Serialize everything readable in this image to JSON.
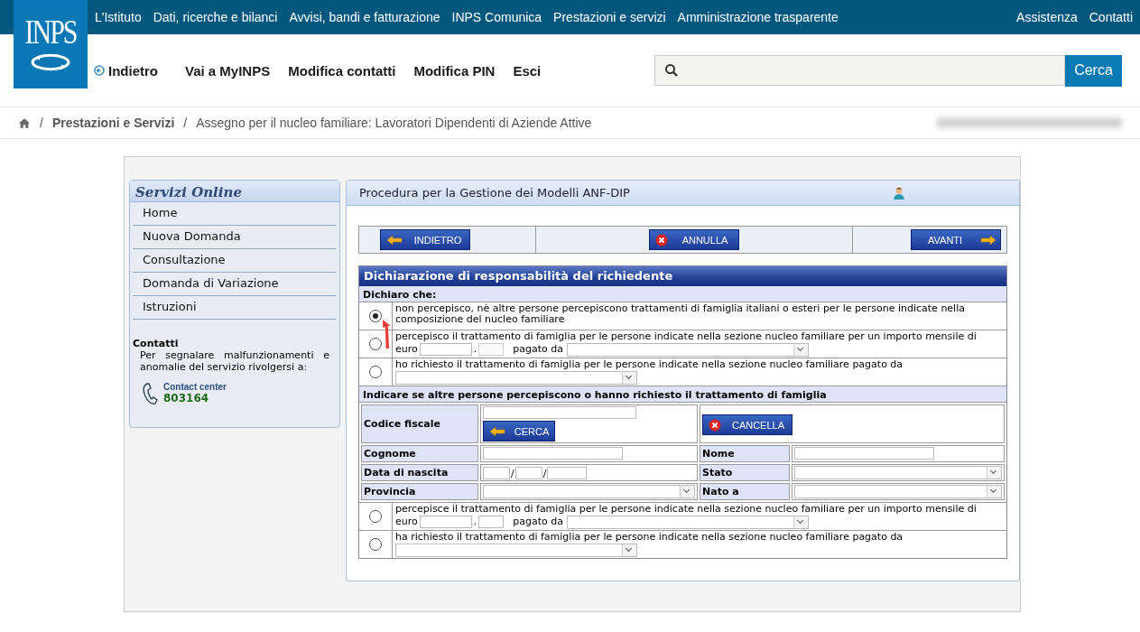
{
  "top_nav": {
    "links": [
      "L'Istituto",
      "Dati, ricerche e bilanci",
      "Avvisi, bandi e fatturazione",
      "INPS Comunica",
      "Prestazioni e servizi",
      "Amministrazione trasparente"
    ],
    "right_links": [
      "Assistenza",
      "Contatti"
    ]
  },
  "logo": {
    "text": "INPS"
  },
  "user_nav": {
    "back": "Indietro",
    "links": [
      "Vai a MyINPS",
      "Modifica contatti",
      "Modifica PIN",
      "Esci"
    ]
  },
  "search": {
    "button": "Cerca"
  },
  "breadcrumb": [
    "Prestazioni e Servizi",
    "Assegno per il nucleo familiare: Lavoratori Dipendenti di Aziende Attive"
  ],
  "breadcrumb_separator": "/",
  "sidebar": {
    "title": "Servizi Online",
    "items": [
      "Home",
      "Nuova Domanda",
      "Consultazione",
      "Domanda di Variazione",
      "Istruzioni"
    ],
    "contacts_title": "Contatti",
    "contacts_text": "Per segnalare malfunzionamenti e anomalie del servizio rivolgersi a:",
    "contact_label": "Contact center",
    "contact_number": "803164"
  },
  "panel": {
    "title": "Procedura per la Gestione dei Modelli ANF-DIP",
    "buttons": [
      {
        "kind": "back",
        "label": "INDIETRO"
      },
      {
        "kind": "cancel",
        "label": "ANNULLA"
      },
      {
        "kind": "next",
        "label": "AVANTI"
      }
    ]
  },
  "declaration": {
    "title": "Dichiarazione di responsabilità del richiedente",
    "subtitle": "Dichiaro che:",
    "options": [
      {
        "kind": "plain",
        "selected": true,
        "text": "non percepisco, nè altre persone percepiscono trattamenti di famiglia italiani o esteri per le persone indicate nella composizione del nucleo familiare"
      },
      {
        "kind": "amount",
        "selected": false,
        "text": "percepisco il trattamento di famiglia per le persone indicate nella sezione nucleo familiare per un importo mensile di",
        "euro": "euro",
        "dot": ".",
        "payer": "pagato da"
      },
      {
        "kind": "payer",
        "selected": false,
        "text": "ho richiesto il trattamento di famiglia per le persone indicate nella sezione nucleo familiare pagato da"
      }
    ],
    "others_title": "Indicare se altre persone percepiscono o hanno richiesto il trattamento di famiglia",
    "person": {
      "tax_code": "Codice fiscale",
      "search": "CERCA",
      "clear": "CANCELLA",
      "surname": "Cognome",
      "name": "Nome",
      "birth_date": "Data di nascita",
      "date_sep": [
        "/",
        "/"
      ],
      "state": "Stato",
      "province": "Provincia",
      "born_in": "Nato a"
    },
    "others_options": [
      {
        "kind": "amount",
        "selected": false,
        "text": "percepisce il trattamento di famiglia per le persone indicate nella sezione nucleo familiare per un importo mensile di",
        "euro": "euro",
        "dot": ".",
        "payer": "pagato da"
      },
      {
        "kind": "payer",
        "selected": false,
        "text": "ha richiesto il trattamento di famiglia per le persone indicate nella sezione nucleo familiare pagato da"
      }
    ]
  }
}
